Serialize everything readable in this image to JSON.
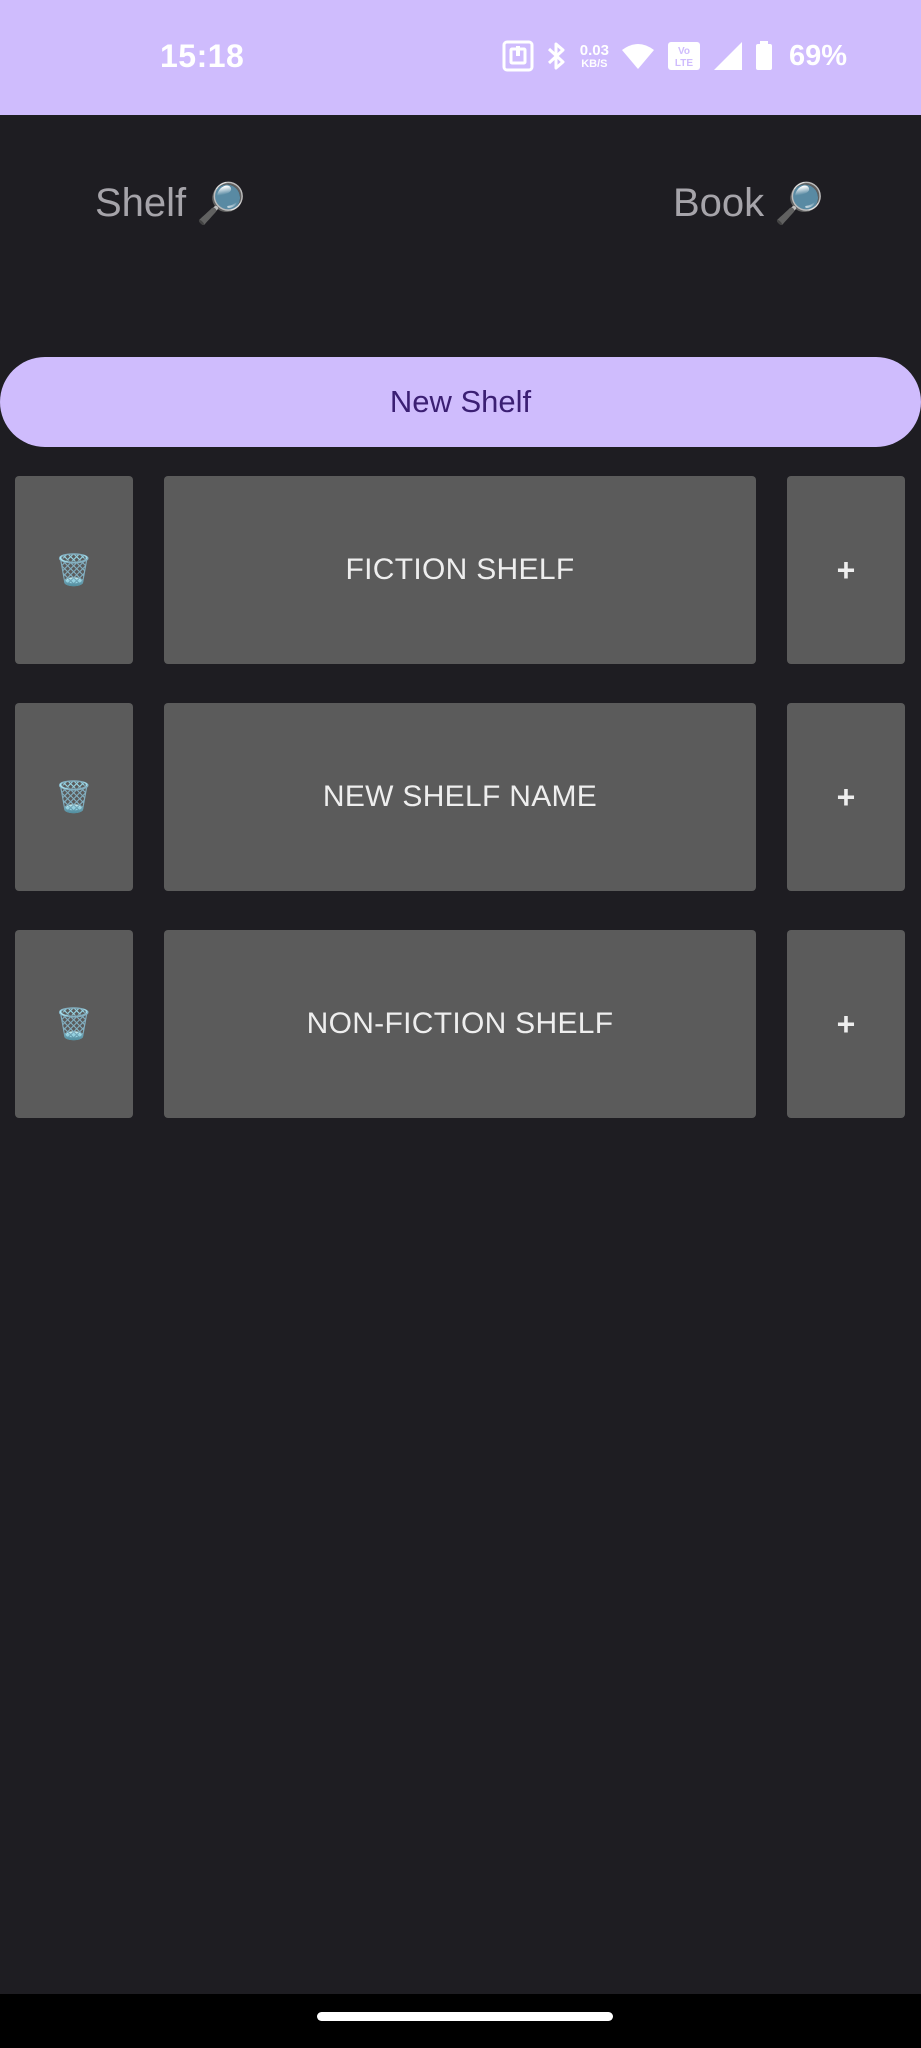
{
  "status_bar": {
    "time": "15:18",
    "net_speed_value": "0.03",
    "net_speed_unit": "KB/S",
    "volte_label": "Vo LTE",
    "battery_percent": "69%",
    "background_color": "#cfbcfd",
    "icons": [
      "nfc-icon",
      "bluetooth-icon",
      "wifi-icon",
      "volte-icon",
      "cell-signal-icon",
      "battery-icon"
    ]
  },
  "header": {
    "shelf_search_label": "Shelf",
    "book_search_label": "Book",
    "search_icon": "🔎"
  },
  "new_shelf_button": {
    "label": "New Shelf",
    "background_color": "#cfbcfd",
    "text_color": "#3b1f73"
  },
  "shelves": [
    {
      "name": "FICTION SHELF",
      "delete_icon": "🗑️",
      "add_label": "+"
    },
    {
      "name": "NEW SHELF NAME",
      "delete_icon": "🗑️",
      "add_label": "+"
    },
    {
      "name": "NON-FICTION SHELF",
      "delete_icon": "🗑️",
      "add_label": "+"
    }
  ],
  "theme": {
    "background": "#1e1d22",
    "tile_color": "#5b5b5b"
  }
}
